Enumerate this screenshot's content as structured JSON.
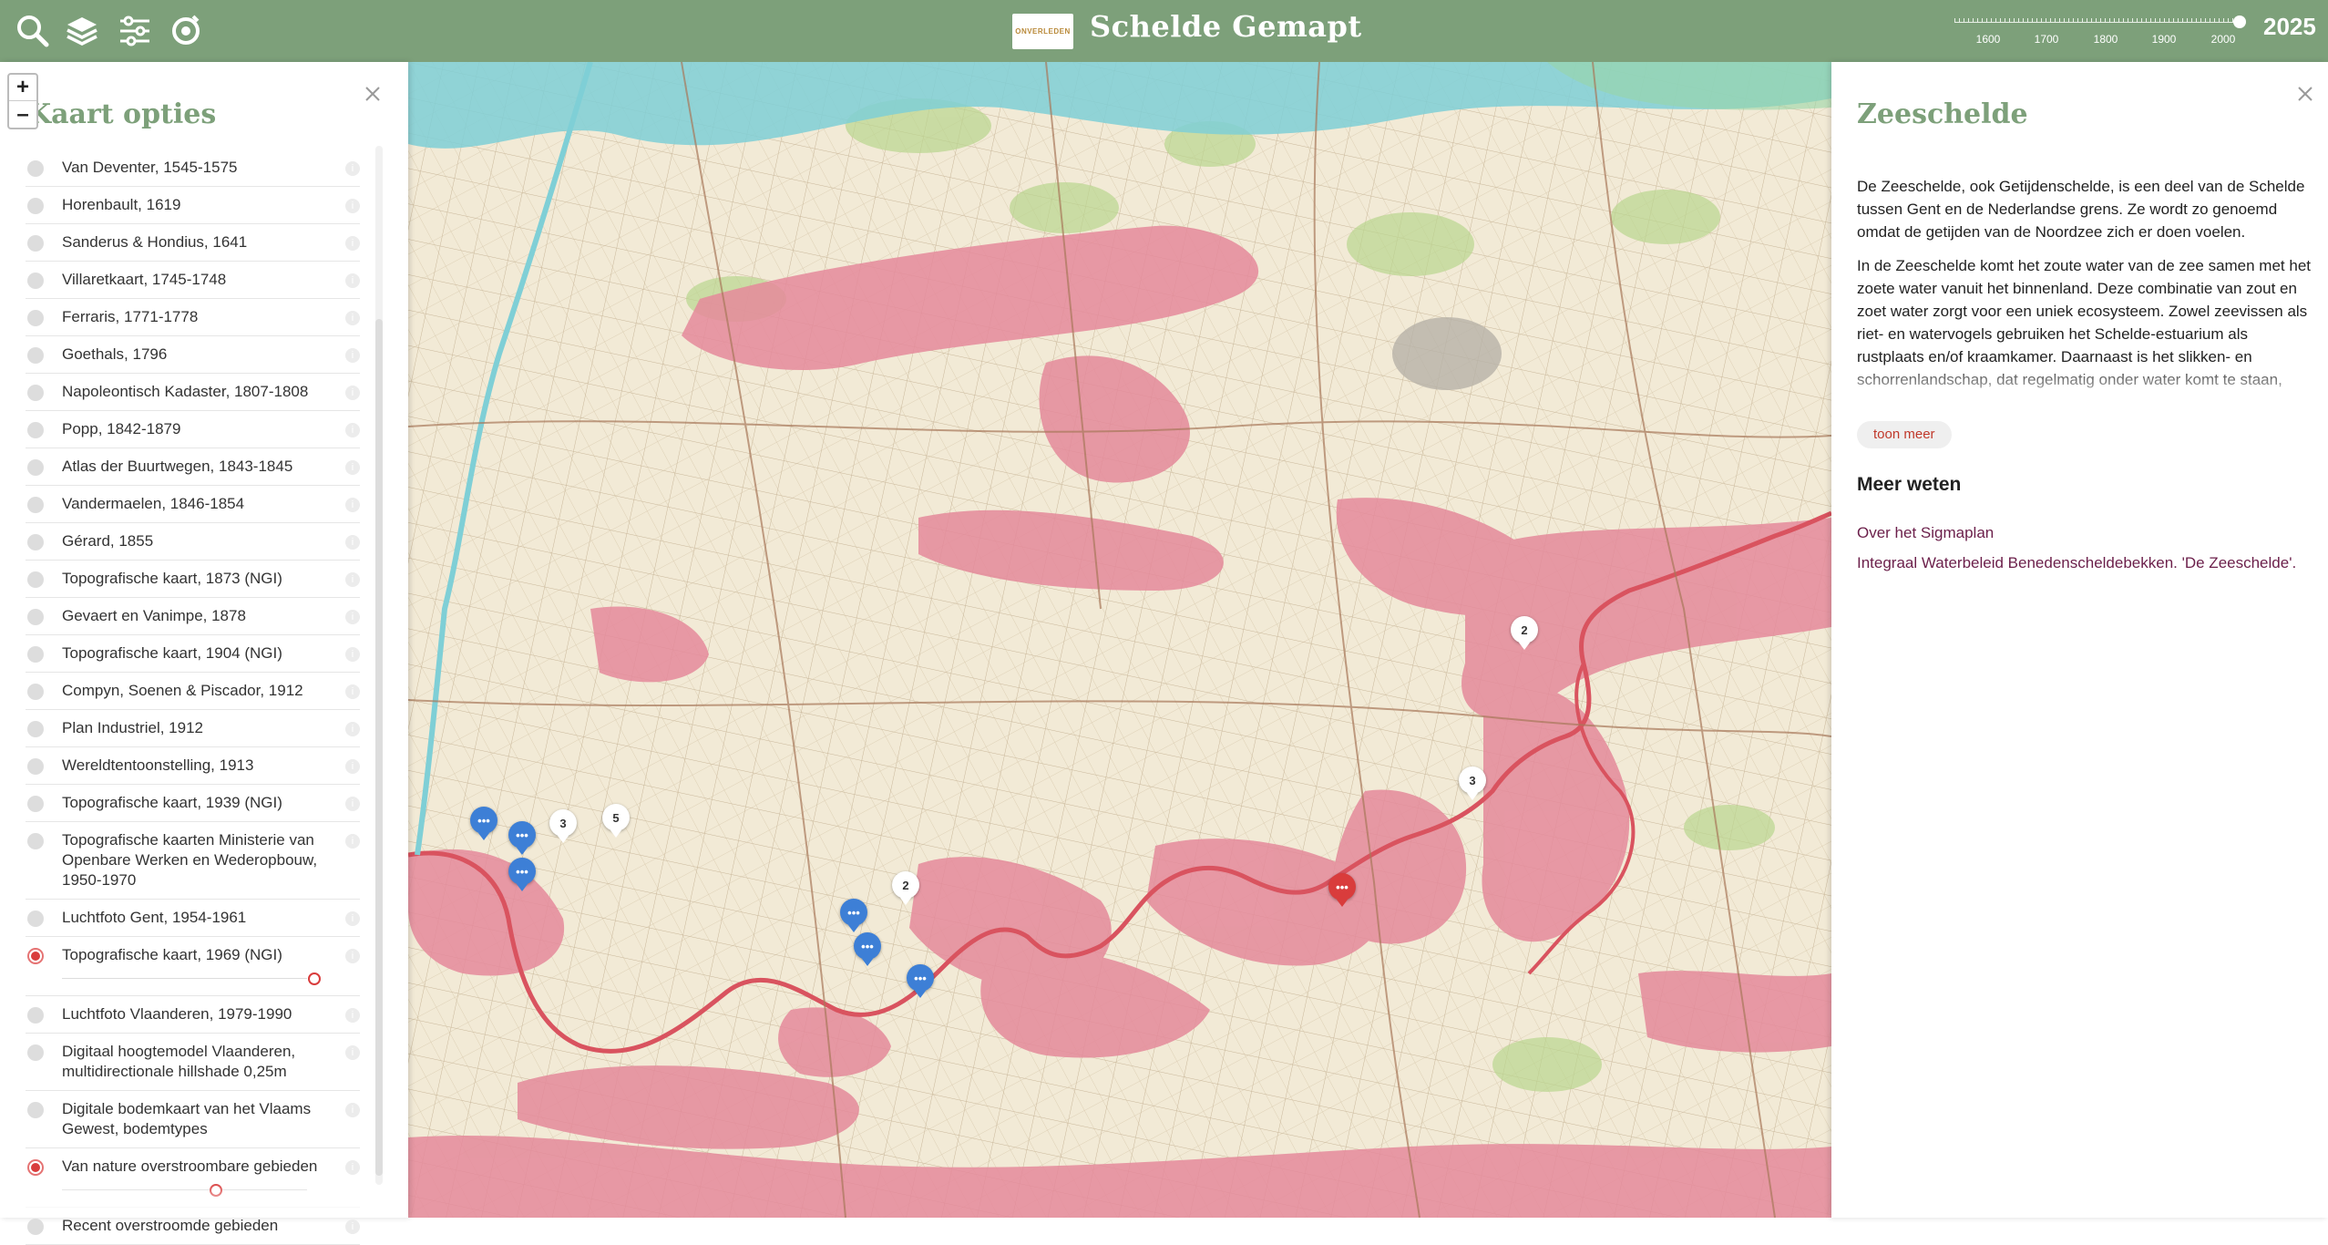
{
  "header": {
    "title": "Schelde Gemapt",
    "logo_text": "ONVERLEDEN",
    "year": "2025",
    "timeline_labels": [
      "1600",
      "1700",
      "1800",
      "1900",
      "2000"
    ],
    "tools": [
      "search-icon",
      "layers-icon",
      "sliders-icon",
      "locate-icon"
    ]
  },
  "zoom": {
    "in": "+",
    "out": "–"
  },
  "left_panel": {
    "title": "Kaart opties",
    "layers": [
      {
        "label": "Van Deventer, 1545-1575",
        "active": false
      },
      {
        "label": "Horenbault, 1619",
        "active": false
      },
      {
        "label": "Sanderus & Hondius, 1641",
        "active": false
      },
      {
        "label": "Villaretkaart, 1745-1748",
        "active": false
      },
      {
        "label": "Ferraris, 1771-1778",
        "active": false
      },
      {
        "label": "Goethals, 1796",
        "active": false
      },
      {
        "label": "Napoleontisch Kadaster, 1807-1808",
        "active": false
      },
      {
        "label": "Popp, 1842-1879",
        "active": false
      },
      {
        "label": "Atlas der Buurtwegen, 1843-1845",
        "active": false
      },
      {
        "label": "Vandermaelen, 1846-1854",
        "active": false
      },
      {
        "label": "Gérard, 1855",
        "active": false
      },
      {
        "label": "Topografische kaart, 1873 (NGI)",
        "active": false
      },
      {
        "label": "Gevaert en Vanimpe, 1878",
        "active": false
      },
      {
        "label": "Topografische kaart, 1904 (NGI)",
        "active": false
      },
      {
        "label": "Compyn, Soenen & Piscador, 1912",
        "active": false
      },
      {
        "label": "Plan Industriel, 1912",
        "active": false
      },
      {
        "label": "Wereldtentoonstelling, 1913",
        "active": false
      },
      {
        "label": "Topografische kaart, 1939 (NGI)",
        "active": false
      },
      {
        "label": "Topografische kaarten Ministerie van Openbare Werken en Wederopbouw, 1950-1970",
        "active": false
      },
      {
        "label": "Luchtfoto Gent, 1954-1961",
        "active": false
      },
      {
        "label": "Topografische kaart, 1969 (NGI)",
        "active": true,
        "opacity": 1.0
      },
      {
        "label": "Luchtfoto Vlaanderen, 1979-1990",
        "active": false
      },
      {
        "label": "Digitaal hoogtemodel Vlaanderen, multidirectionale hillshade 0,25m",
        "active": false
      },
      {
        "label": "Digitale bodemkaart van het Vlaams Gewest, bodemtypes",
        "active": false
      },
      {
        "label": "Van nature overstroombare gebieden",
        "active": true,
        "opacity": 0.6
      },
      {
        "label": "Recent overstroomde gebieden",
        "active": false
      }
    ]
  },
  "map": {
    "markers": [
      {
        "type": "blue",
        "label": "•••"
      },
      {
        "type": "blue",
        "label": "•••"
      },
      {
        "type": "blue",
        "label": "•••"
      },
      {
        "type": "white",
        "label": "3"
      },
      {
        "type": "white",
        "label": "5"
      },
      {
        "type": "blue",
        "label": "•••"
      },
      {
        "type": "blue",
        "label": "•••"
      },
      {
        "type": "white",
        "label": "2"
      },
      {
        "type": "blue",
        "label": "•••"
      },
      {
        "type": "red",
        "label": "•••"
      },
      {
        "type": "white",
        "label": "3"
      },
      {
        "type": "white",
        "label": "2"
      }
    ],
    "colors": {
      "flood": "#e58a9b",
      "river": "#d9535f",
      "water": "#7fcfd6",
      "base": "#f2ead6"
    }
  },
  "right_panel": {
    "title": "Zeeschelde",
    "paragraphs": [
      "De Zeeschelde, ook Getijdenschelde, is een deel van de Schelde tussen Gent en de Nederlandse grens. Ze wordt zo genoemd omdat de getijden van de Noordzee zich er doen voelen.",
      "In de Zeeschelde komt het zoute water van de zee samen met het zoete water vanuit het binnenland. Deze combinatie van zout en zoet water zorgt voor een uniek ecosysteem. Zowel zeevissen als riet- en watervogels gebruiken het Schelde-estuarium als rustplaats en/of kraamkamer. Daarnaast is het slikken- en schorrenlandschap, dat regelmatig onder water komt te staan,"
    ],
    "toon_meer": "toon meer",
    "meer_weten": "Meer weten",
    "links": [
      "Over het Sigmaplan",
      "Integraal Waterbeleid Benedenscheldebekken. 'De Zeeschelde'."
    ]
  }
}
